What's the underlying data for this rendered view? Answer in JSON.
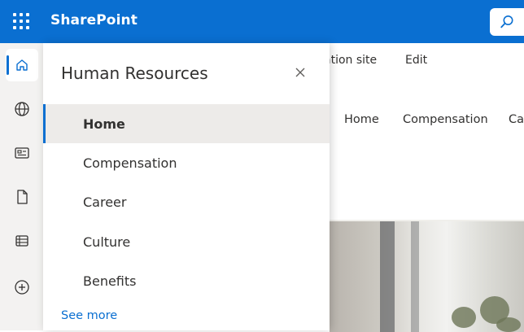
{
  "topbar": {
    "app_name": "SharePoint",
    "icons": [
      "waffle-icon",
      "search-icon"
    ]
  },
  "rail": {
    "items": [
      {
        "name": "home-icon",
        "active": true
      },
      {
        "name": "globe-icon",
        "active": false
      },
      {
        "name": "news-icon",
        "active": false
      },
      {
        "name": "file-icon",
        "active": false
      },
      {
        "name": "lists-icon",
        "active": false
      },
      {
        "name": "add-icon",
        "active": false
      }
    ]
  },
  "command_bar": {
    "items": [
      "ation site",
      "Edit"
    ]
  },
  "site_nav": {
    "links": [
      "Home",
      "Compensation",
      "Ca"
    ]
  },
  "panel": {
    "title": "Human Resources",
    "items": [
      {
        "label": "Home",
        "selected": true
      },
      {
        "label": "Compensation",
        "selected": false
      },
      {
        "label": "Career",
        "selected": false
      },
      {
        "label": "Culture",
        "selected": false
      },
      {
        "label": "Benefits",
        "selected": false
      }
    ],
    "see_more": "See more"
  },
  "colors": {
    "brand": "#0a6fd1",
    "selected_bg": "#edebe9",
    "rail_bg": "#f3f2f1"
  }
}
